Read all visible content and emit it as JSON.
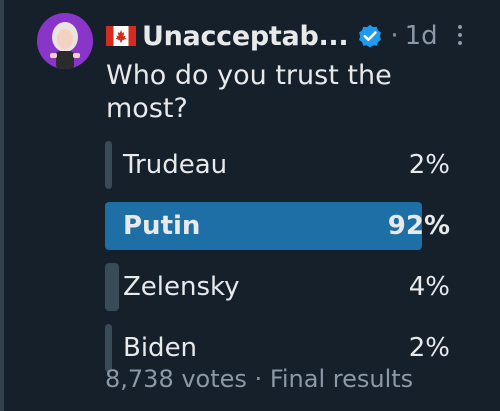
{
  "tweet": {
    "author_name": "Unacceptab...",
    "flag_icon": "canada-flag-icon",
    "verified_icon": "verified-badge-icon",
    "separator": "·",
    "timestamp": "1d",
    "question": "Who do you trust the most?"
  },
  "poll": {
    "options": [
      {
        "label": "Trudeau",
        "percent": "2%",
        "fraction": 0.02,
        "winner": false
      },
      {
        "label": "Putin",
        "percent": "92%",
        "fraction": 0.92,
        "winner": true
      },
      {
        "label": "Zelensky",
        "percent": "4%",
        "fraction": 0.04,
        "winner": false
      },
      {
        "label": "Biden",
        "percent": "2%",
        "fraction": 0.02,
        "winner": false
      }
    ],
    "votes": "8,738 votes",
    "footer_separator": "·",
    "status": "Final results"
  },
  "colors": {
    "background": "#15202b",
    "text": "#e7e9ea",
    "muted": "#8b98a5",
    "winner_bar": "#1d6fa5",
    "bar": "#3b4a57",
    "verified": "#1d9bf0"
  }
}
